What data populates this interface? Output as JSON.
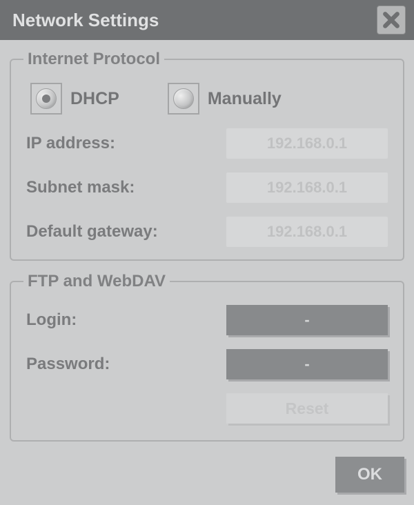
{
  "title": "Network Settings",
  "internet_protocol": {
    "legend": "Internet Protocol",
    "dhcp_label": "DHCP",
    "manually_label": "Manually",
    "selected": "dhcp",
    "ip_address_label": "IP address:",
    "ip_address_value": "192.168.0.1",
    "subnet_mask_label": "Subnet mask:",
    "subnet_mask_value": "192.168.0.1",
    "default_gateway_label": "Default gateway:",
    "default_gateway_value": "192.168.0.1"
  },
  "ftp_webdav": {
    "legend": "FTP and WebDAV",
    "login_label": "Login:",
    "login_value": "-",
    "password_label": "Password:",
    "password_value": "-",
    "reset_label": "Reset"
  },
  "ok_label": "OK"
}
